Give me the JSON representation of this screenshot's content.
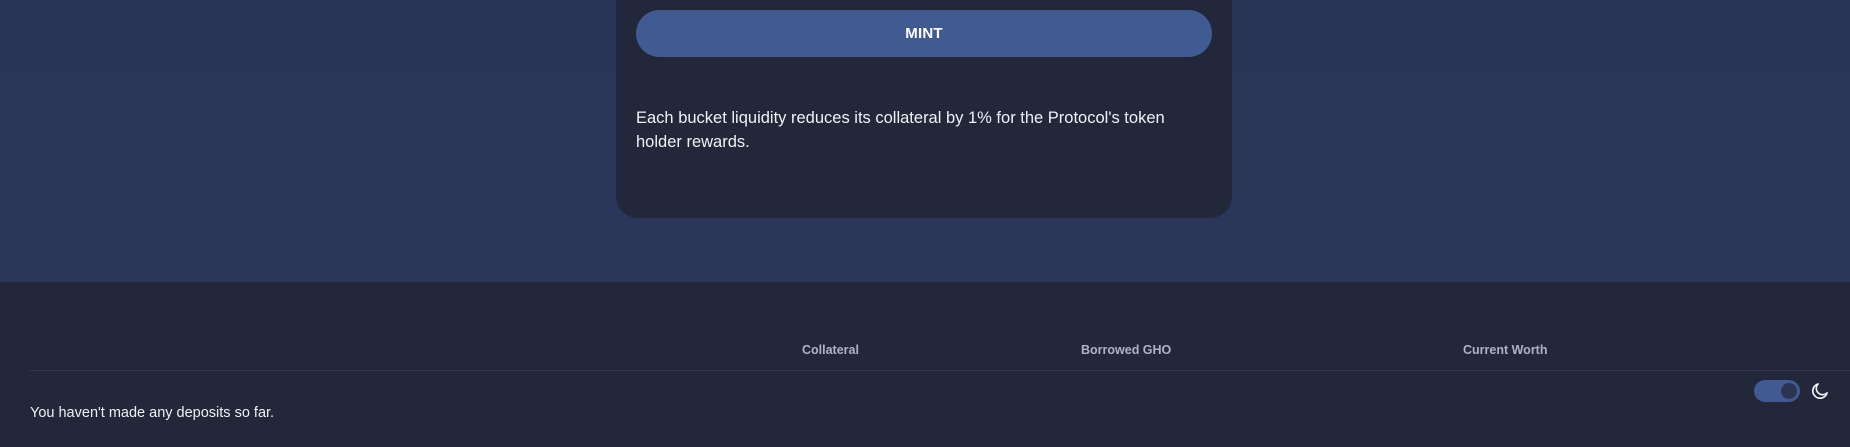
{
  "mint_card": {
    "button_label": "MINT",
    "note": "Each bucket liquidity reduces its collateral by 1% for the Protocol's token holder rewards."
  },
  "deposits_table": {
    "columns": [
      "Collateral",
      "Borrowed GHO",
      "Current Worth"
    ],
    "empty_message": "You haven't made any deposits so far."
  },
  "theme": {
    "dark_mode_enabled": true,
    "icon": "moon-icon"
  },
  "colors": {
    "page_background": "#293659",
    "card_background": "#222739",
    "accent": "#405b92"
  }
}
